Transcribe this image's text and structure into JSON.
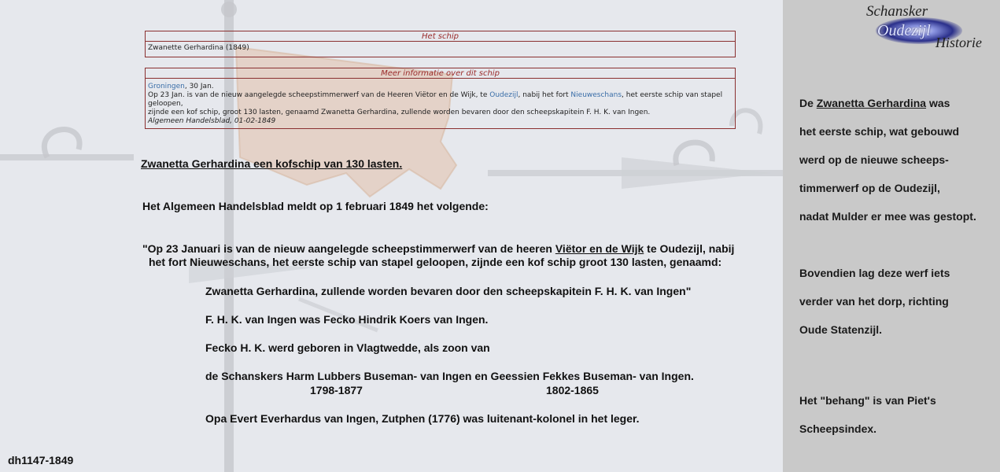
{
  "ship_box": {
    "header": "Het schip",
    "name": "Zwanette Gerhardina (1849)"
  },
  "info_box": {
    "header": "Meer informatie over dit schip",
    "place": "Groningen",
    "date": ", 30 Jan.",
    "line2_a": "Op 23 Jan. is van de nieuw aangelegde scheepstimmerwerf van de Heeren Viëtor en de Wijk, te ",
    "link_oudezijl": "Oudezijl",
    "line2_b": ", nabij het fort ",
    "link_nieuweschans": "Nieuweschans",
    "line2_c": ", het eerste schip van stapel geloopen,",
    "line3": "zijnde een kof schip, groot 130 lasten, genaamd Zwanetta Gerhardina, zullende worden bevaren door den scheepskapitein F. H. K. van Ingen.",
    "source": "Algemeen Handelsblad, 01-02-1849"
  },
  "main": {
    "heading": "Zwanetta Gerhardina een kofschip van 130 lasten.",
    "intro": "Het Algemeen Handelsblad meldt op 1 februari 1849 het volgende:",
    "quote_a": "\"Op 23 Januari is van de nieuw aangelegde scheepstimmerwerf van de heeren ",
    "quote_link": "Viëtor en de Wijk",
    "quote_b": " te Oudezijl, nabij",
    "quote_line2": "het fort Nieuweschans, het eerste schip van stapel geloopen, zijnde een kof schip groot 130 lasten, genaamd:",
    "quote_line3": "Zwanetta Gerhardina, zullende worden bevaren door den scheepskapitein F. H. K. van Ingen\"",
    "p1": "F. H. K. van Ingen was Fecko Hindrik Koers van Ingen.",
    "p2": "Fecko H. K. werd geboren in Vlagtwedde, als zoon van",
    "p3": "de Schanskers Harm Lubbers Buseman- van Ingen en Geessien Fekkes Buseman- van Ingen.",
    "years1": "1798-1877",
    "years2": "1802-1865",
    "p4": "Opa Evert Everhardus van Ingen, Zutphen (1776) was luitenant-kolonel in het leger.",
    "page_id": "dh1147-1849"
  },
  "sidebar": {
    "logo_line1": "Schansker",
    "logo_line2": "Oudezijl",
    "logo_line3": "Historie",
    "s1_a": "De ",
    "s1_link": "Zwanetta Gerhardina",
    "s1_b": " was",
    "s2": "het eerste schip, wat gebouwd",
    "s3": "werd op de nieuwe scheeps-",
    "s4": "timmerwerf op de Oudezijl,",
    "s5": "nadat Mulder er mee was gestopt.",
    "s6": "Bovendien lag deze werf iets",
    "s7": "verder van het dorp, richting",
    "s8": "Oude Statenzijl.",
    "s9": "Het \"behang\" is van Piet's",
    "s10": "Scheepsindex."
  }
}
